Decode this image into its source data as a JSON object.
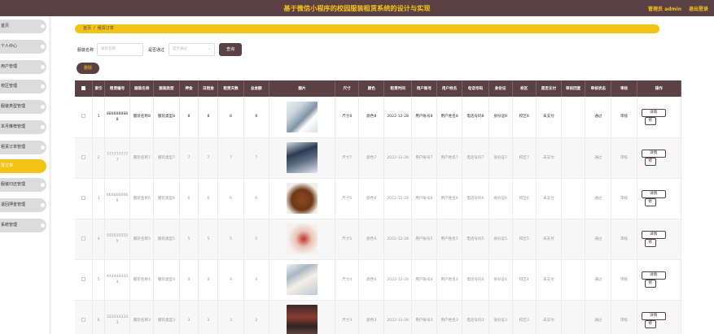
{
  "header": {
    "title": "基于微信小程序的校园服装租赁系统的设计与实现",
    "admin_label": "管理员 admin",
    "logout_label": "退出登录"
  },
  "sidebar": {
    "items": [
      {
        "label": "首页",
        "active": false
      },
      {
        "label": "个人中心",
        "active": false
      },
      {
        "label": "用户管理",
        "active": false
      },
      {
        "label": "校区管理",
        "active": false
      },
      {
        "label": "服装类型管理",
        "active": false
      },
      {
        "label": "本月推荐管理",
        "active": false
      },
      {
        "label": "租赁订单管理",
        "active": false
      },
      {
        "label": "赁订单",
        "active": true
      },
      {
        "label": "服装归还管理",
        "active": false
      },
      {
        "label": "退回押金管理",
        "active": false
      },
      {
        "label": "系统管理",
        "active": false
      }
    ]
  },
  "breadcrumb": {
    "home": "首页",
    "separator": "/",
    "current": "租赁订单"
  },
  "search": {
    "name_label": "服装名称",
    "name_placeholder": "服装名称",
    "paid_label": "是否通过",
    "paid_placeholder": "是否通过",
    "query_label": "查询",
    "delete_label": "删除"
  },
  "table": {
    "headers": [
      "索引",
      "租赁编号",
      "服装名称",
      "服装类型",
      "押金",
      "日租金",
      "租赁天数",
      "总金额",
      "图片",
      "尺寸",
      "颜色",
      "租赁时间",
      "用户账号",
      "用户姓名",
      "电话号码",
      "身份证",
      "校区",
      "是否支付",
      "审核回复",
      "审核状态",
      "审核",
      "操作"
    ],
    "rows": [
      {
        "index": "1",
        "order_no": "8888888888",
        "name": "服装名称8",
        "type": "服装类型8",
        "deposit": "8",
        "daily": "8",
        "days": "8",
        "total": "8",
        "size": "尺寸8",
        "color": "颜色8",
        "time": "2022-12-28",
        "account": "用户账号8",
        "username": "用户姓名8",
        "phone": "电话号码8",
        "idcard": "身份证8",
        "campus": "校区8",
        "paid": "未支付",
        "reply": "",
        "audit_status": "通过",
        "audit": "审核",
        "detail": "详情",
        "more": "修"
      },
      {
        "index": "2",
        "order_no": "7777777777",
        "name": "服装名称7",
        "type": "服装类型7",
        "deposit": "7",
        "daily": "7",
        "days": "7",
        "total": "7",
        "size": "尺寸7",
        "color": "颜色7",
        "time": "2022-12-28",
        "account": "用户账号7",
        "username": "用户姓名7",
        "phone": "电话号码7",
        "idcard": "身份证7",
        "campus": "校区7",
        "paid": "未支付",
        "reply": "",
        "audit_status": "通过",
        "audit": "审核",
        "detail": "详情",
        "more": "修"
      },
      {
        "index": "3",
        "order_no": "6666666666",
        "name": "服装名称6",
        "type": "服装类型6",
        "deposit": "6",
        "daily": "6",
        "days": "6",
        "total": "6",
        "size": "尺寸6",
        "color": "颜色6",
        "time": "2022-12-28",
        "account": "用户账号6",
        "username": "用户姓名6",
        "phone": "电话号码6",
        "idcard": "身份证6",
        "campus": "校区6",
        "paid": "未支付",
        "reply": "",
        "audit_status": "通过",
        "audit": "审核",
        "detail": "详情",
        "more": "修"
      },
      {
        "index": "4",
        "order_no": "5555555555",
        "name": "服装名称5",
        "type": "服装类型5",
        "deposit": "5",
        "daily": "5",
        "days": "5",
        "total": "5",
        "size": "尺寸5",
        "color": "颜色5",
        "time": "2022-12-28",
        "account": "用户账号5",
        "username": "用户姓名5",
        "phone": "电话号码5",
        "idcard": "身份证5",
        "campus": "校区5",
        "paid": "未支付",
        "reply": "",
        "audit_status": "通过",
        "audit": "审核",
        "detail": "详情",
        "more": "修"
      },
      {
        "index": "5",
        "order_no": "4444444444",
        "name": "服装名称4",
        "type": "服装类型4",
        "deposit": "4",
        "daily": "4",
        "days": "4",
        "total": "4",
        "size": "尺寸4",
        "color": "颜色4",
        "time": "2022-12-28",
        "account": "用户账号4",
        "username": "用户姓名4",
        "phone": "电话号码4",
        "idcard": "身份证4",
        "campus": "校区4",
        "paid": "未支付",
        "reply": "",
        "audit_status": "通过",
        "audit": "审核",
        "detail": "详情",
        "more": "修"
      },
      {
        "index": "6",
        "order_no": "3333333333",
        "name": "服装名称3",
        "type": "服装类型3",
        "deposit": "3",
        "daily": "3",
        "days": "3",
        "total": "3",
        "size": "尺寸3",
        "color": "颜色3",
        "time": "2022-12-28",
        "account": "用户账号3",
        "username": "用户姓名3",
        "phone": "电话号码3",
        "idcard": "身份证3",
        "campus": "校区3",
        "paid": "未支付",
        "reply": "",
        "audit_status": "通过",
        "audit": "审核",
        "detail": "详情",
        "more": "修"
      }
    ]
  },
  "colors": {
    "primary": "#5b4144",
    "accent": "#f4c318",
    "success": "#21b36a"
  }
}
